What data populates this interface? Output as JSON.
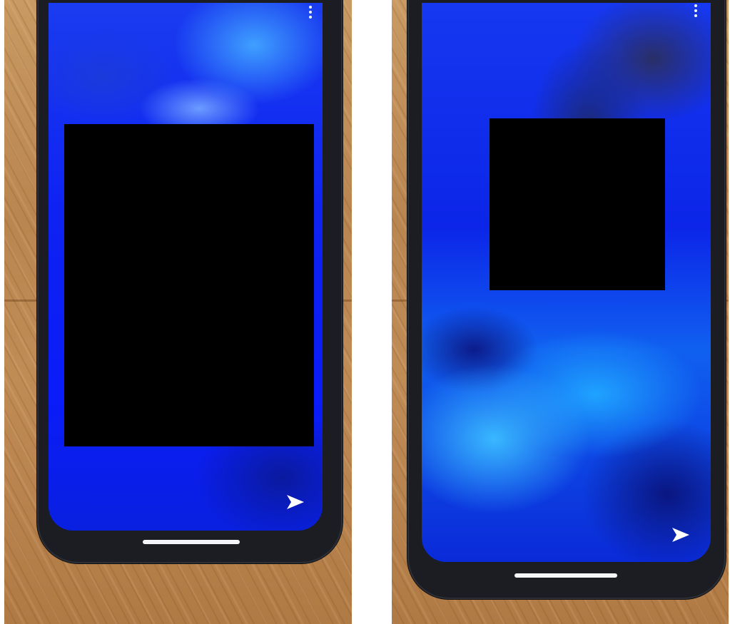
{
  "screens": [
    {
      "id": "left",
      "icons": {
        "menu": "more-vertical-icon",
        "send": "send-arrow-icon"
      },
      "colors": {
        "screen_tint": "#0e22f2",
        "redaction": "#000000"
      }
    },
    {
      "id": "right",
      "icons": {
        "menu": "more-vertical-icon",
        "send": "send-arrow-icon"
      },
      "colors": {
        "screen_tint": "#1060f0",
        "redaction": "#000000"
      }
    }
  ],
  "background": {
    "surface": "wooden-table",
    "color": "#c08c56"
  }
}
